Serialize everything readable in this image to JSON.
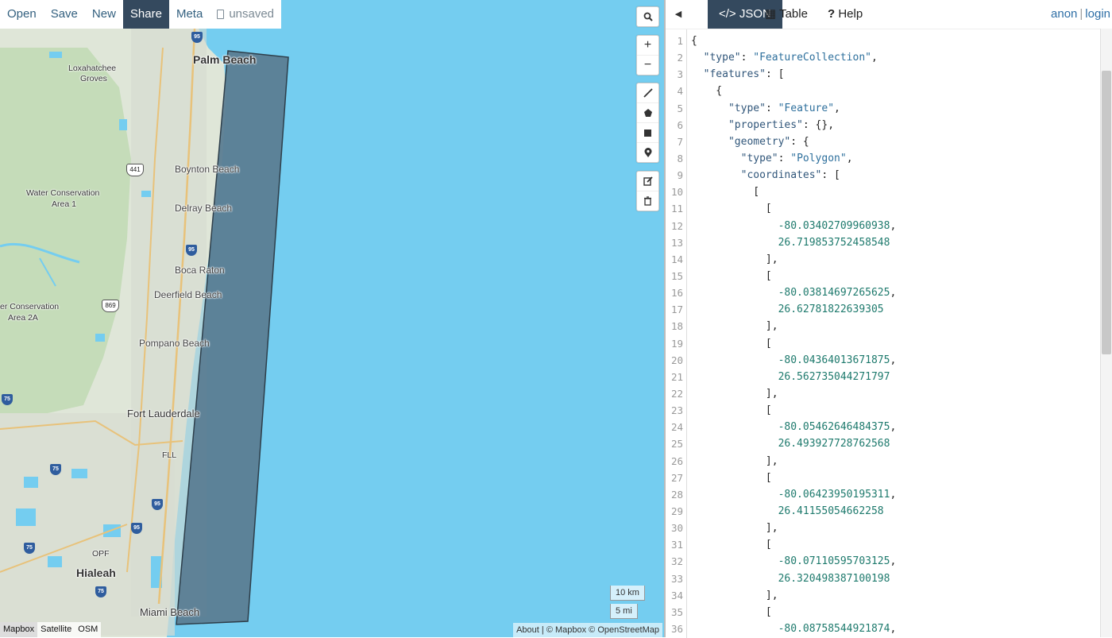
{
  "toolbar": {
    "open": "Open",
    "save": "Save",
    "new": "New",
    "share": "Share",
    "meta": "Meta",
    "unsaved": "unsaved"
  },
  "map": {
    "labels": {
      "palm_beach": "Palm Beach",
      "loxahatchee": "Loxahatchee",
      "groves": "Groves",
      "boynton": "Boynton Beach",
      "water_cons_1a": "Water Conservation",
      "area_1": "Area 1",
      "delray": "Delray Beach",
      "boca": "Boca Raton",
      "deerfield": "Deerfield Beach",
      "water_cons_2a": "er Conservation",
      "area_2a": "Area 2A",
      "pompano": "Pompano Beach",
      "fort_lauderdale": "Fort Lauderdale",
      "fll": "FLL",
      "opf": "OPF",
      "hialeah": "Hialeah",
      "miami_beach": "Miami Beach"
    },
    "shields": {
      "us441": "441",
      "sr869": "869",
      "i95_a": "95",
      "i95_b": "95",
      "i95_c": "95",
      "i95_d": "95",
      "i75_a": "75",
      "i75_b": "75",
      "i75_c": "75",
      "i75_d": "75"
    },
    "scale_km": "10 km",
    "scale_mi": "5 mi",
    "attribution_about": "About",
    "attribution_sep": "|",
    "attribution_text": "© Mapbox © OpenStreetMap",
    "layers": [
      "Mapbox",
      "Satellite",
      "OSM"
    ],
    "active_layer": "Mapbox",
    "colors": {
      "water": "#74cdf0",
      "land": "#dde4d6",
      "polygon_fill": "#5b7d92",
      "polygon_stroke": "#2d3e4a"
    }
  },
  "panel": {
    "tabs": {
      "json": "JSON",
      "table": "Table",
      "help": "Help"
    },
    "active_tab": "JSON",
    "user": {
      "anon": "anon",
      "sep": "|",
      "login": "login"
    }
  },
  "editor": {
    "lines": [
      {
        "n": "1",
        "t": "{"
      },
      {
        "n": "2",
        "t": "  \"type\": \"FeatureCollection\","
      },
      {
        "n": "3",
        "t": "  \"features\": ["
      },
      {
        "n": "4",
        "t": "    {"
      },
      {
        "n": "5",
        "t": "      \"type\": \"Feature\","
      },
      {
        "n": "6",
        "t": "      \"properties\": {},"
      },
      {
        "n": "7",
        "t": "      \"geometry\": {"
      },
      {
        "n": "8",
        "t": "        \"type\": \"Polygon\","
      },
      {
        "n": "9",
        "t": "        \"coordinates\": ["
      },
      {
        "n": "10",
        "t": "          ["
      },
      {
        "n": "11",
        "t": "            ["
      },
      {
        "n": "12",
        "t": "              -80.03402709960938,"
      },
      {
        "n": "13",
        "t": "              26.719853752458548"
      },
      {
        "n": "14",
        "t": "            ],"
      },
      {
        "n": "15",
        "t": "            ["
      },
      {
        "n": "16",
        "t": "              -80.03814697265625,"
      },
      {
        "n": "17",
        "t": "              26.62781822639305"
      },
      {
        "n": "18",
        "t": "            ],"
      },
      {
        "n": "19",
        "t": "            ["
      },
      {
        "n": "20",
        "t": "              -80.04364013671875,"
      },
      {
        "n": "21",
        "t": "              26.562735044271797"
      },
      {
        "n": "22",
        "t": "            ],"
      },
      {
        "n": "23",
        "t": "            ["
      },
      {
        "n": "24",
        "t": "              -80.05462646484375,"
      },
      {
        "n": "25",
        "t": "              26.493927728762568"
      },
      {
        "n": "26",
        "t": "            ],"
      },
      {
        "n": "27",
        "t": "            ["
      },
      {
        "n": "28",
        "t": "              -80.06423950195311,"
      },
      {
        "n": "29",
        "t": "              26.41155054662258"
      },
      {
        "n": "30",
        "t": "            ],"
      },
      {
        "n": "31",
        "t": "            ["
      },
      {
        "n": "32",
        "t": "              -80.07110595703125,"
      },
      {
        "n": "33",
        "t": "              26.320498387100198"
      },
      {
        "n": "34",
        "t": "            ],"
      },
      {
        "n": "35",
        "t": "            ["
      },
      {
        "n": "36",
        "t": "              -80.08758544921874,"
      }
    ]
  }
}
